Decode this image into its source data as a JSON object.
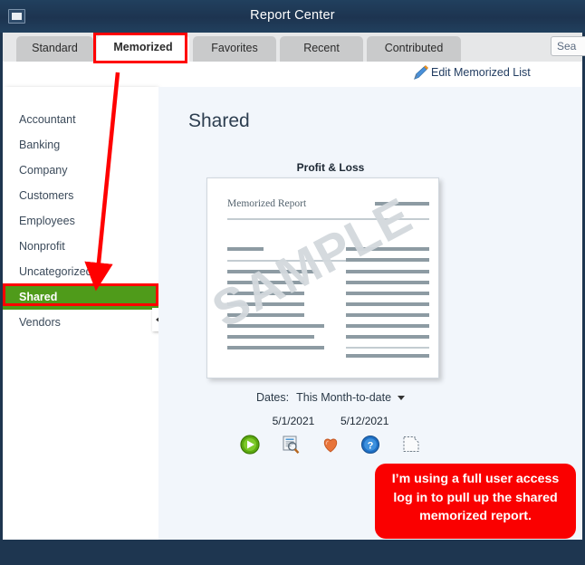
{
  "window": {
    "title": "Report Center",
    "control_icon": "window-restore-icon"
  },
  "tabs": [
    {
      "label": "Standard",
      "active": false
    },
    {
      "label": "Memorized",
      "active": true
    },
    {
      "label": "Favorites",
      "active": false
    },
    {
      "label": "Recent",
      "active": false
    },
    {
      "label": "Contributed",
      "active": false
    }
  ],
  "search": {
    "placeholder": "Search",
    "value": "Sea"
  },
  "toolbar": {
    "edit_memorized_label": "Edit Memorized List",
    "pencil_icon": "pencil-icon"
  },
  "sidebar": {
    "items": [
      {
        "label": "Accountant",
        "selected": false
      },
      {
        "label": "Banking",
        "selected": false
      },
      {
        "label": "Company",
        "selected": false
      },
      {
        "label": "Customers",
        "selected": false
      },
      {
        "label": "Employees",
        "selected": false
      },
      {
        "label": "Nonprofit",
        "selected": false
      },
      {
        "label": "Uncategorized",
        "selected": false
      },
      {
        "label": "Shared",
        "selected": true
      },
      {
        "label": "Vendors",
        "selected": false
      }
    ],
    "collapse_icon": "chevron-left-icon"
  },
  "main": {
    "heading": "Shared",
    "report": {
      "title": "Profit & Loss",
      "thumbnail_heading": "Memorized Report",
      "watermark": "SAMPLE"
    },
    "dates": {
      "label": "Dates:",
      "value": "This Month-to-date",
      "from": "5/1/2021",
      "to": "5/12/2021"
    },
    "actions": [
      {
        "name": "run-report-icon",
        "title": "Run"
      },
      {
        "name": "display-report-icon",
        "title": "Display"
      },
      {
        "name": "favorite-heart-icon",
        "title": "Favorite"
      },
      {
        "name": "help-icon",
        "title": "Help"
      },
      {
        "name": "film-info-icon",
        "title": "Info"
      }
    ]
  },
  "annotations": {
    "callout_text": "I’m using a full user access log in to pull up the shared memorized report.",
    "callout_color": "#fa0000",
    "highlight_color": "#ff0000",
    "selected_color": "#4f9b1a",
    "arrow": "red-arrow"
  }
}
